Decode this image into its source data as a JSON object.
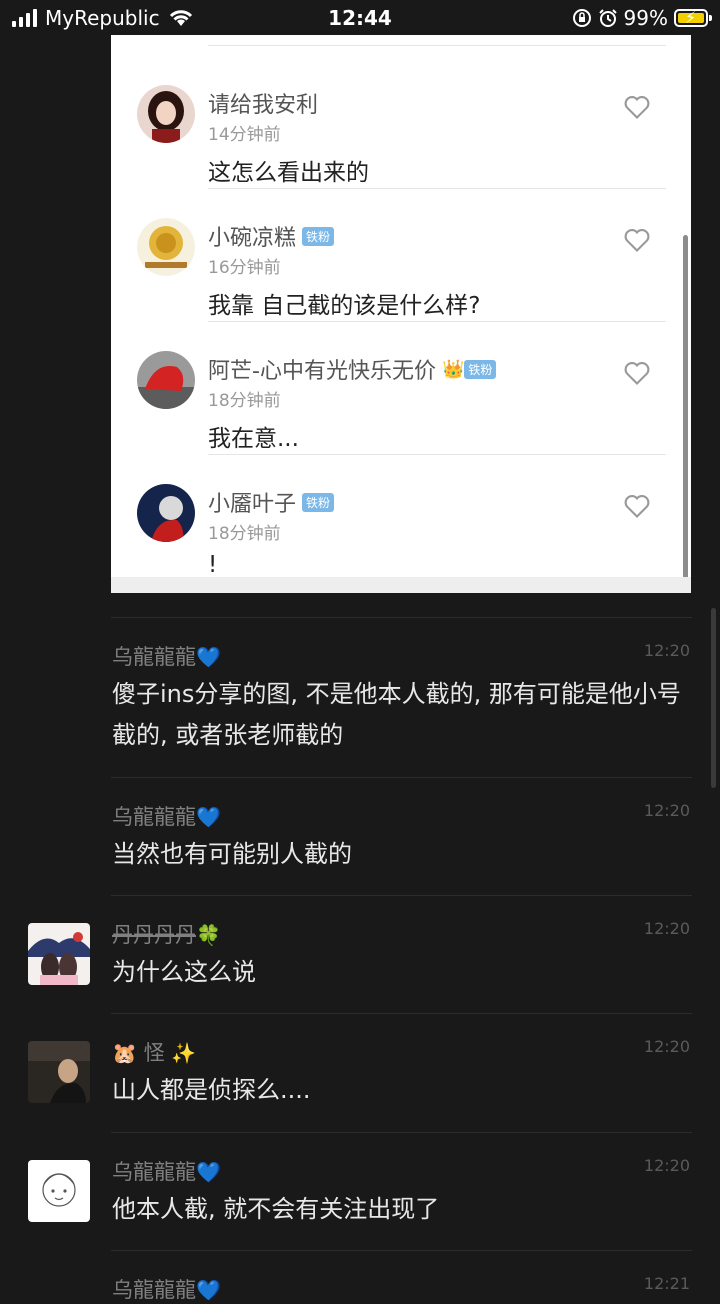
{
  "status_bar": {
    "carrier": "MyRepublic",
    "time": "12:44",
    "battery": "99%"
  },
  "quoted_comments": [
    {
      "name": "请给我安利",
      "time": "14分钟前",
      "text": "这怎么看出来的",
      "badge": ""
    },
    {
      "name": "小碗凉糕",
      "time": "16分钟前",
      "text": "我靠 自己截的该是什么样?",
      "badge": "铁粉"
    },
    {
      "name": "阿芒-心中有光快乐无价",
      "time": "18分钟前",
      "text": "我在意...",
      "badge": "铁粉"
    },
    {
      "name": "小靥叶子",
      "time": "18分钟前",
      "text": "!",
      "badge": "铁粉"
    }
  ],
  "messages": [
    {
      "name": "乌龍龍龍",
      "name_emoji": "💙",
      "time": "12:20",
      "text": "傻子ins分享的图, 不是他本人截的, 那有可能是他小号截的, 或者张老师截的"
    },
    {
      "name": "乌龍龍龍",
      "name_emoji": "💙",
      "time": "12:20",
      "text": "当然也有可能别人截的"
    },
    {
      "name": "丹丹丹丹",
      "name_emoji": "🍀",
      "time": "12:20",
      "text": "为什么这么说"
    },
    {
      "name": "怪",
      "name_prefix_emoji": "🐹",
      "name_emoji": "✨",
      "time": "12:20",
      "text": "山人都是侦探么...."
    },
    {
      "name": "乌龍龍龍",
      "name_emoji": "💙",
      "time": "12:20",
      "text": "他本人截, 就不会有关注出现了"
    },
    {
      "name": "乌龍龍龍",
      "name_emoji": "💙",
      "time": "12:21",
      "text": ""
    }
  ],
  "colors": {
    "background": "#191919",
    "card": "#ffffff",
    "badge": "#7bb8e8",
    "battery_charging": "#f2d000"
  }
}
